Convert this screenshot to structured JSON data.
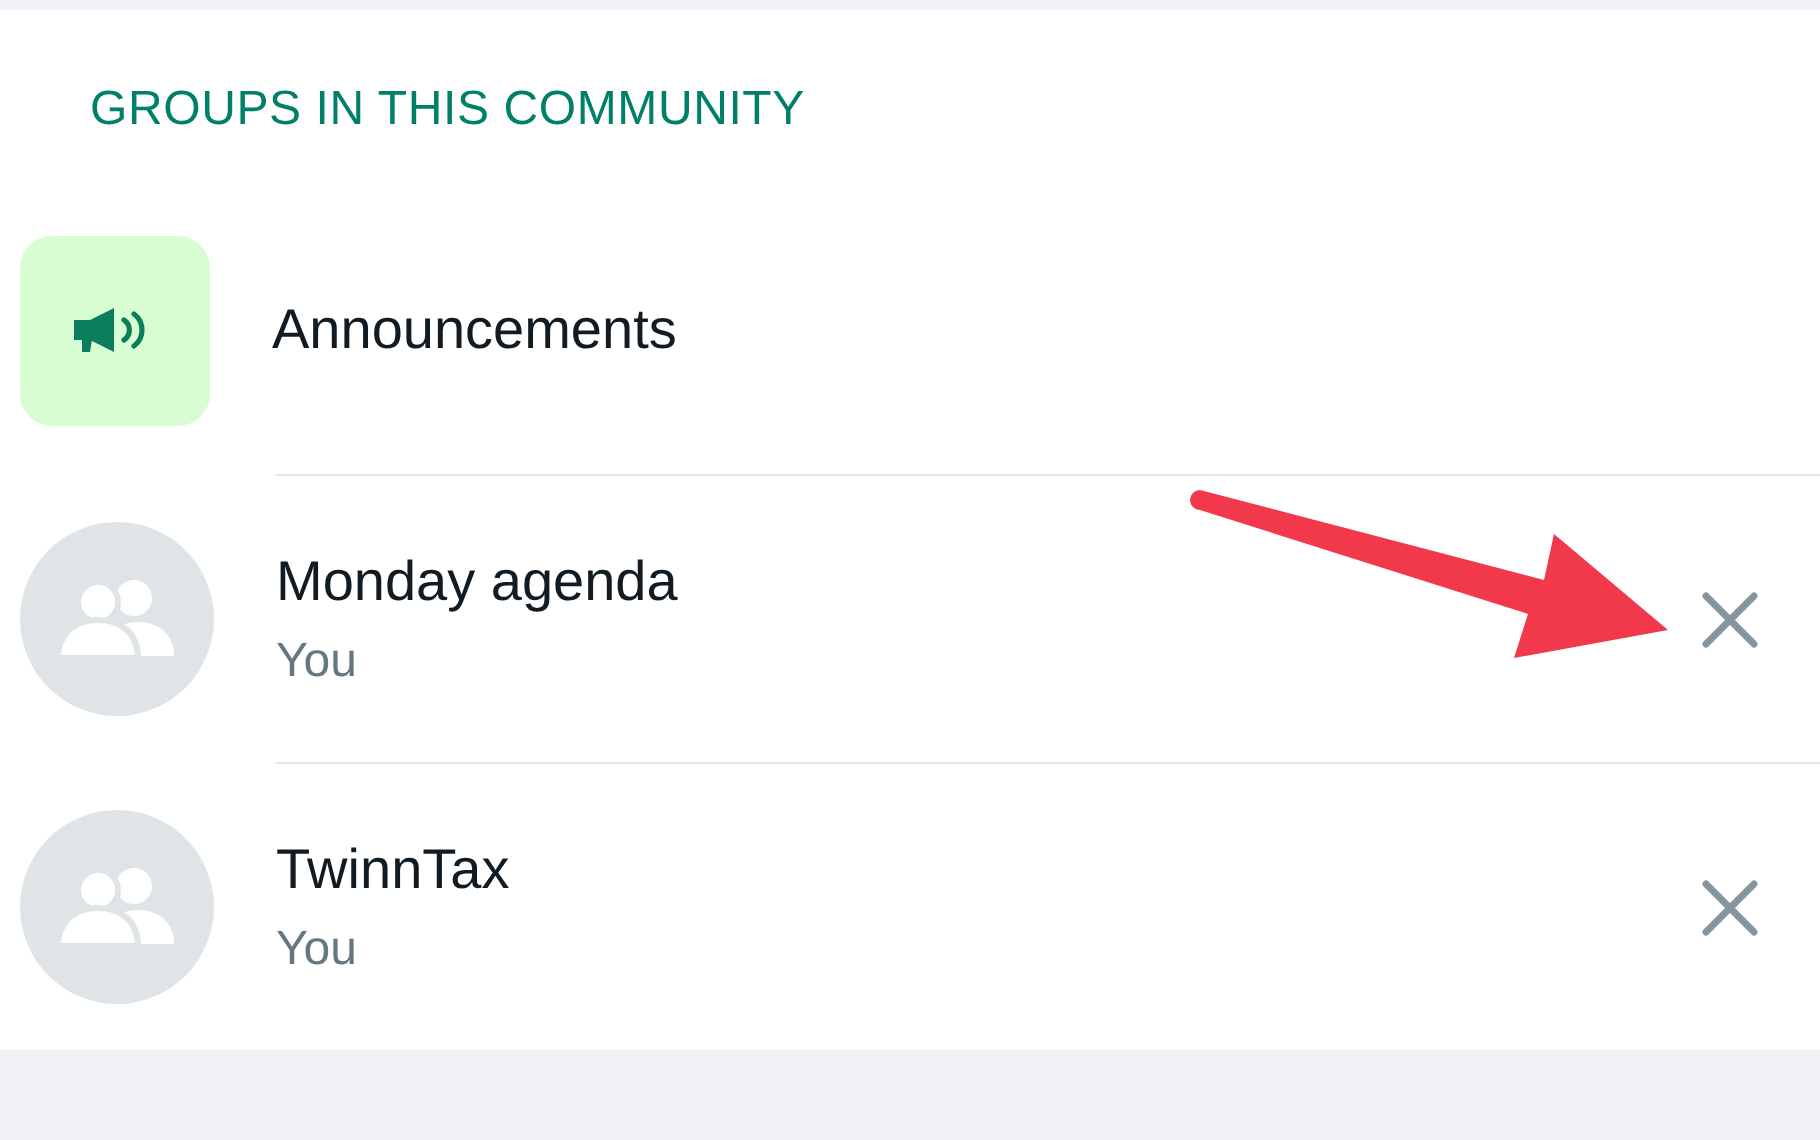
{
  "section_title": "GROUPS IN THIS COMMUNITY",
  "groups": [
    {
      "kind": "announcement",
      "name": "Announcements",
      "removable": false
    },
    {
      "kind": "group",
      "name": "Monday agenda",
      "subtitle": "You",
      "removable": true
    },
    {
      "kind": "group",
      "name": "TwinnTax",
      "subtitle": "You",
      "removable": true
    }
  ],
  "annotations": [
    {
      "kind": "arrow"
    }
  ]
}
